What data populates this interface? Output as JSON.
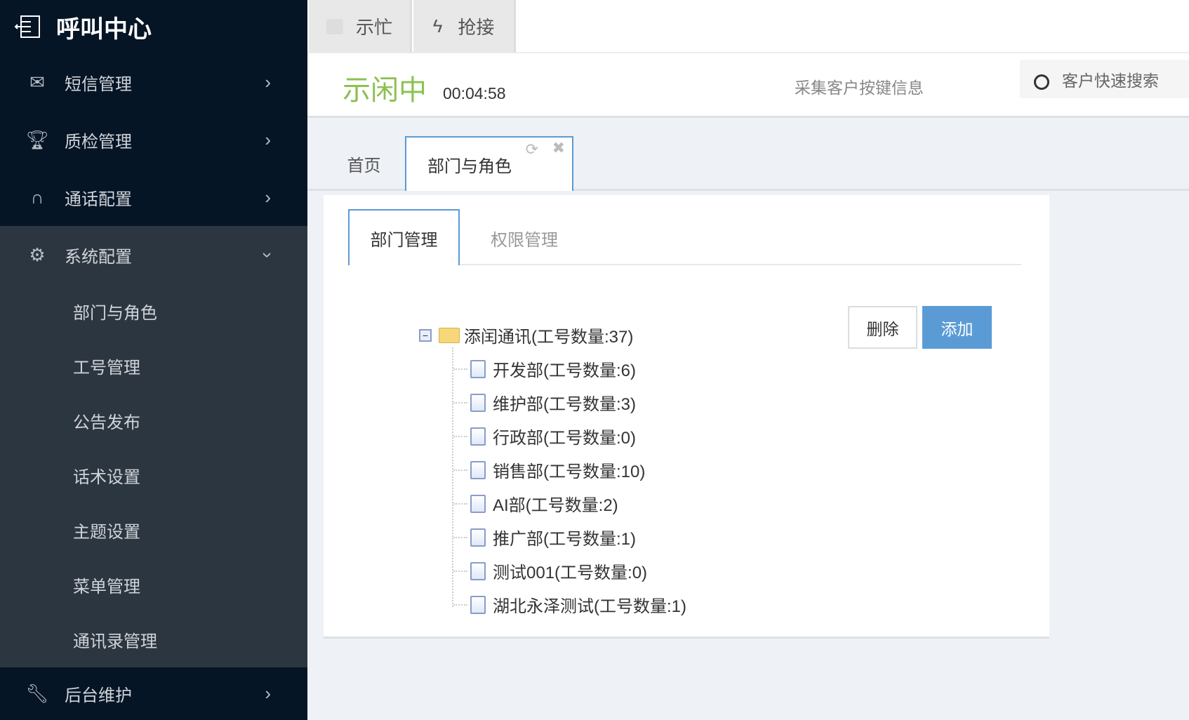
{
  "app": {
    "title": "呼叫中心"
  },
  "sidebar": {
    "items": [
      {
        "label": "短信管理",
        "icon": "envelope-icon"
      },
      {
        "label": "质检管理",
        "icon": "trophy-icon"
      },
      {
        "label": "通话配置",
        "icon": "headphones-icon"
      },
      {
        "label": "系统配置",
        "icon": "gear-icon"
      },
      {
        "label": "后台维护",
        "icon": "wrench-icon"
      }
    ],
    "sub_items": [
      "部门与角色",
      "工号管理",
      "公告发布",
      "话术设置",
      "主题设置",
      "菜单管理",
      "通讯录管理"
    ]
  },
  "topbar": {
    "busy": "示忙",
    "grab": "抢接"
  },
  "status": {
    "state": "示闲中",
    "timer": "00:04:58",
    "collect": "采集客户按键信息",
    "search_placeholder": "客户快速搜索",
    "accent": "#8cc152"
  },
  "page_tabs": {
    "home": "首页",
    "current": "部门与角色"
  },
  "inner_tabs": {
    "dept": "部门管理",
    "perm": "权限管理"
  },
  "buttons": {
    "delete": "删除",
    "add": "添加"
  },
  "tree": {
    "root": "添闰通讯(工号数量:37)",
    "children": [
      "开发部(工号数量:6)",
      "维护部(工号数量:3)",
      "行政部(工号数量:0)",
      "销售部(工号数量:10)",
      "AI部(工号数量:2)",
      "推广部(工号数量:1)",
      "测试001(工号数量:0)",
      "湖北永泽测试(工号数量:1)"
    ]
  }
}
